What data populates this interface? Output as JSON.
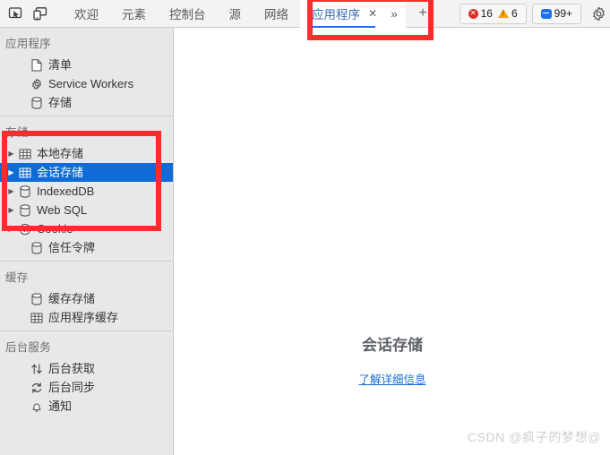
{
  "toolbar": {
    "inspect_icon": "inspect-element-icon",
    "device_icon": "device-toolbar-icon",
    "tabs": [
      {
        "label": "欢迎",
        "active": false
      },
      {
        "label": "元素",
        "active": false
      },
      {
        "label": "控制台",
        "active": false
      },
      {
        "label": "源",
        "active": false
      },
      {
        "label": "网络",
        "active": false
      },
      {
        "label": "应用程序",
        "active": true
      }
    ],
    "close_glyph": "✕",
    "more_glyph": "»",
    "plus_glyph": "+",
    "badges": {
      "errors": "16",
      "warnings": "6",
      "messages": "99+"
    },
    "settings_icon": "gear-icon"
  },
  "sidebar": {
    "sections": [
      {
        "title": "应用程序",
        "items": [
          {
            "label": "清单",
            "icon": "manifest-file-icon",
            "twisty": false,
            "selected": false
          },
          {
            "label": "Service Workers",
            "icon": "gear-icon",
            "twisty": false,
            "selected": false
          },
          {
            "label": "存储",
            "icon": "database-icon",
            "twisty": false,
            "selected": false
          }
        ]
      },
      {
        "title": "存储",
        "items": [
          {
            "label": "本地存储",
            "icon": "table-grid-icon",
            "twisty": true,
            "selected": false
          },
          {
            "label": "会话存储",
            "icon": "table-grid-icon",
            "twisty": true,
            "selected": true
          },
          {
            "label": "IndexedDB",
            "icon": "database-icon",
            "twisty": true,
            "selected": false
          },
          {
            "label": "Web SQL",
            "icon": "database-icon",
            "twisty": true,
            "selected": false
          },
          {
            "label": "Cookie",
            "icon": "cookie-icon",
            "twisty": true,
            "selected": false
          },
          {
            "label": "信任令牌",
            "icon": "database-icon",
            "twisty": false,
            "selected": false
          }
        ]
      },
      {
        "title": "缓存",
        "items": [
          {
            "label": "缓存存储",
            "icon": "database-icon",
            "twisty": false,
            "selected": false
          },
          {
            "label": "应用程序缓存",
            "icon": "table-grid-icon",
            "twisty": false,
            "selected": false
          }
        ]
      },
      {
        "title": "后台服务",
        "items": [
          {
            "label": "后台获取",
            "icon": "arrows-up-down-icon",
            "twisty": false,
            "selected": false
          },
          {
            "label": "后台同步",
            "icon": "sync-refresh-icon",
            "twisty": false,
            "selected": false
          },
          {
            "label": "通知",
            "icon": "bell-icon",
            "twisty": false,
            "selected": false
          }
        ]
      }
    ]
  },
  "main": {
    "empty_title": "会话存储",
    "empty_link": "了解详细信息",
    "watermark": "CSDN @疯子的梦想@"
  },
  "colors": {
    "selection_blue": "#0f6cd6",
    "accent_blue": "#1a73e8",
    "annotation_red": "#fb2c2c",
    "sidebar_bg": "#e8e8e8",
    "toolbar_bg": "#f3f3f3"
  }
}
